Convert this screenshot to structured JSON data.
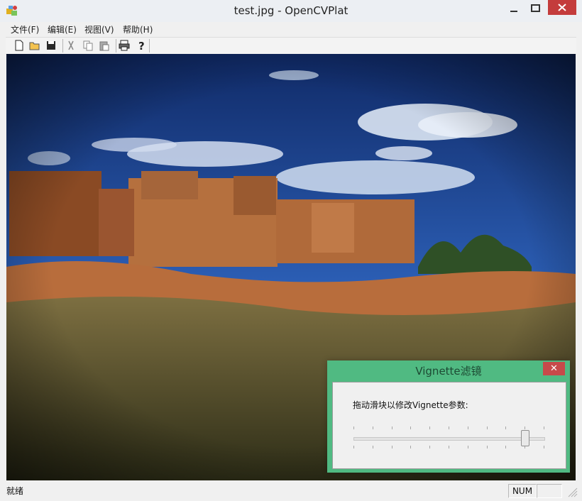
{
  "window": {
    "title": "test.jpg - OpenCVPlat"
  },
  "menu": [
    "文件(F)",
    "编辑(E)",
    "视图(V)",
    "帮助(H)"
  ],
  "toolbar": {
    "icons": [
      "new-file-icon",
      "open-folder-icon",
      "save-icon",
      "cut-icon",
      "copy-icon",
      "paste-icon",
      "print-icon",
      "help-icon"
    ]
  },
  "status": {
    "left": "就绪",
    "num": "NUM"
  },
  "dialog": {
    "title": "Vignette滤镜",
    "label": "拖动滑块以修改Vignette参数:",
    "close_symbol": "✕",
    "slider_fraction": 0.9
  },
  "colors": {
    "dialog_frame": "#50ba82",
    "close_button": "#c74a4a",
    "sky": "#1b3e86"
  }
}
